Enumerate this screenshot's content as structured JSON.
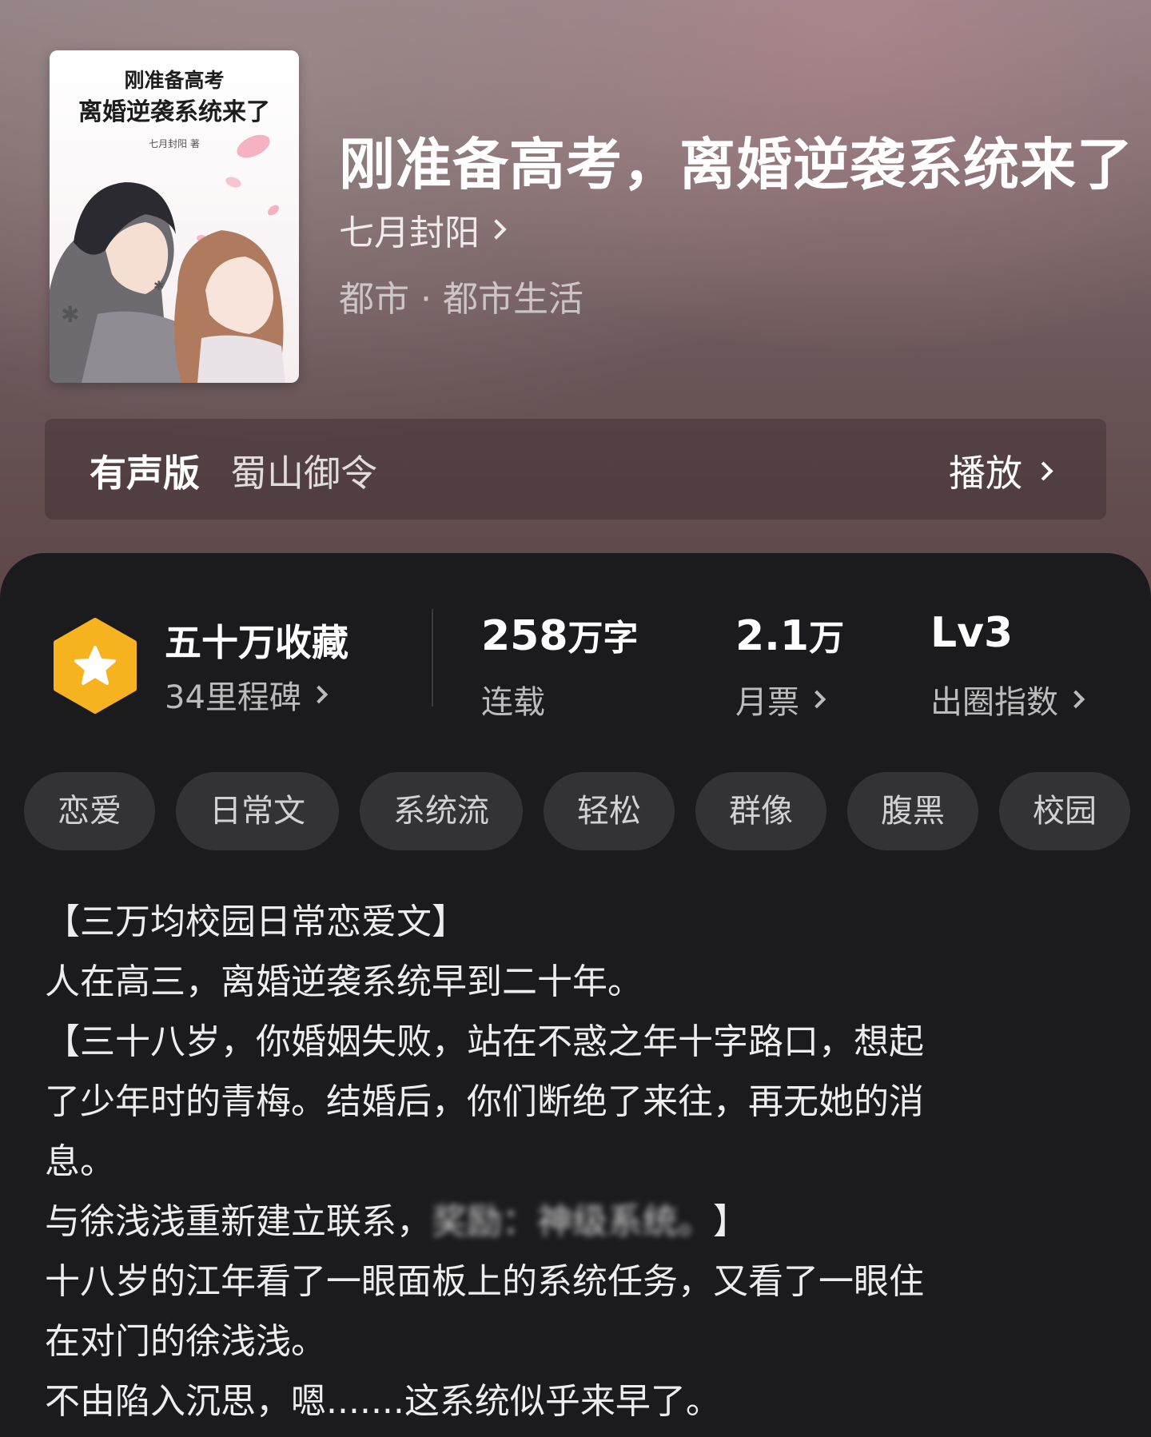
{
  "book": {
    "cover": {
      "title_line1": "刚准备高考",
      "title_line2": "离婚逆袭系统来了",
      "author_line": "七月封阳 著"
    },
    "title": "刚准备高考，离婚逆袭系统来了",
    "author": "七月封阳",
    "genre": "都市 · 都市生活"
  },
  "audio": {
    "label": "有声版",
    "narrator": "蜀山御令",
    "play_label": "播放"
  },
  "stats": {
    "favorites": "五十万收藏",
    "milestone": "34里程碑",
    "words_value": "258",
    "words_unit": "万字",
    "words_status": "连载",
    "tickets_value": "2.1",
    "tickets_unit": "万",
    "tickets_label": "月票",
    "level_value": "Lv3",
    "level_label": "出圈指数"
  },
  "tags": [
    "恋爱",
    "日常文",
    "系统流",
    "轻松",
    "群像",
    "腹黑",
    "校园"
  ],
  "description": {
    "line1": "【三万均校园日常恋爱文】",
    "line2": "人在高三，离婚逆袭系统早到二十年。",
    "line3": "【三十八岁，你婚姻失败，站在不惑之年十字路口，想起",
    "line4": "了少年时的青梅。结婚后，你们断绝了来往，再无她的消",
    "line5": "息。",
    "line6_start": "与徐浅浅重新建立联系，",
    "line6_blurred": "奖励：神级系统。",
    "line6_end": "】",
    "line7": "十八岁的江年看了一眼面板上的系统任务，又看了一眼住",
    "line8": "在对门的徐浅浅。",
    "line9": "不由陷入沉思，嗯.......这系统似乎来早了。"
  },
  "colors": {
    "badge": "#f6b21f",
    "panel": "#1b1b1d",
    "tag_bg": "#333336"
  }
}
